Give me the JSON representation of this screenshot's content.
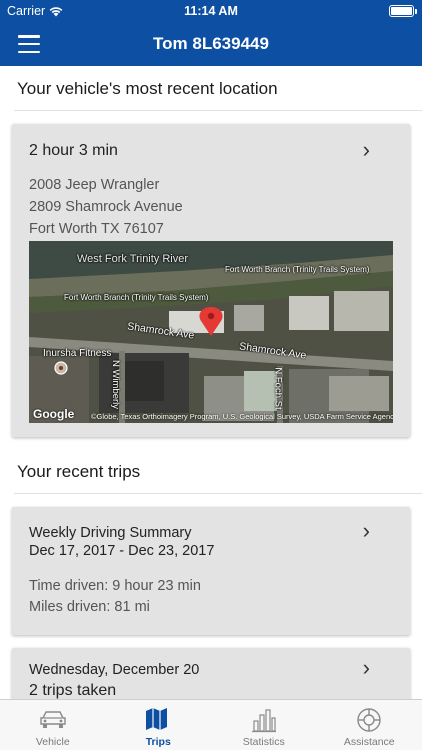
{
  "status_bar": {
    "carrier": "Carrier",
    "time": "11:14 AM"
  },
  "nav": {
    "title": "Tom 8L639449"
  },
  "location_section": {
    "heading": "Your vehicle's most recent location",
    "card": {
      "elapsed": "2 hour 3 min",
      "vehicle": "2008 Jeep Wrangler",
      "street": "2809 Shamrock Avenue",
      "city": "Fort Worth TX 76107"
    },
    "map": {
      "river": "West Fork Trinity River",
      "branch_1": "Fort Worth Branch (Trinity Trails System)",
      "branch_2": "Fort Worth Branch (Trinity Trails System)",
      "street_1": "Shamrock Ave",
      "street_2": "Shamrock Ave",
      "poi": "Inursha Fitness",
      "road_1": "N Wimberly",
      "road_2": "N Foch St",
      "logo": "Google",
      "attribution": "©Globe, Texas Orthoimagery Program, U.S. Geological Survey, USDA Farm Service Agency"
    }
  },
  "trips_section": {
    "heading": "Your recent trips",
    "summary": {
      "title": "Weekly Driving Summary",
      "range": "Dec 17, 2017 - Dec 23, 2017",
      "time_driven": "Time driven: 9 hour 23 min",
      "miles_driven": "Miles driven: 81 mi"
    },
    "day": {
      "title": "Wednesday, December 20",
      "trips": "2 trips taken"
    }
  },
  "tabs": [
    {
      "label": "Vehicle",
      "icon": "car-icon"
    },
    {
      "label": "Trips",
      "icon": "map-icon"
    },
    {
      "label": "Statistics",
      "icon": "bar-chart-icon"
    },
    {
      "label": "Assistance",
      "icon": "lifebuoy-icon"
    }
  ],
  "colors": {
    "brand": "#0d4fa3",
    "card": "#e3e3e3",
    "pin": "#e53935"
  }
}
